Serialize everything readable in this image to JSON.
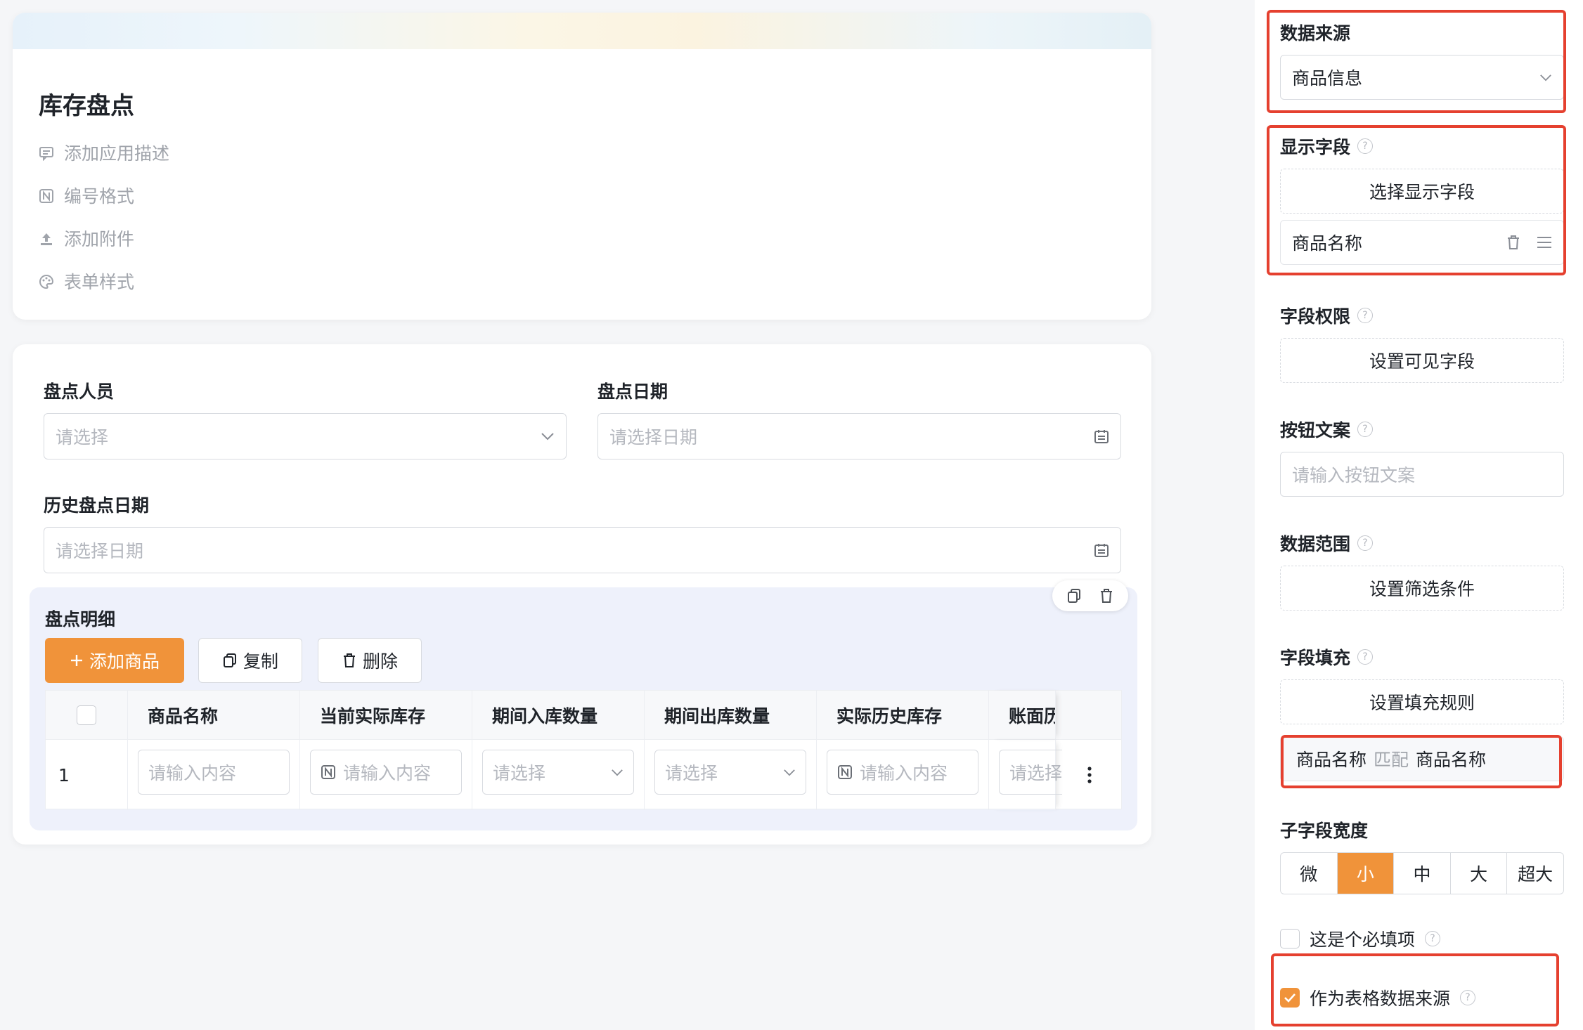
{
  "form": {
    "title": "库存盘点",
    "meta": [
      {
        "label": "添加应用描述",
        "icon": "comment-icon"
      },
      {
        "label": "编号格式",
        "icon": "numbering-icon"
      },
      {
        "label": "添加附件",
        "icon": "upload-icon"
      },
      {
        "label": "表单样式",
        "icon": "palette-icon"
      }
    ],
    "fields": {
      "inventory_person": {
        "label": "盘点人员",
        "placeholder": "请选择"
      },
      "inventory_date": {
        "label": "盘点日期",
        "placeholder": "请选择日期"
      },
      "history_date": {
        "label": "历史盘点日期",
        "placeholder": "请选择日期"
      }
    },
    "detail": {
      "title": "盘点明细",
      "add_label": "添加商品",
      "copy_label": "复制",
      "delete_label": "删除",
      "columns": [
        "商品名称",
        "当前实际库存",
        "期间入库数量",
        "期间出库数量",
        "实际历史库存",
        "账面历史"
      ],
      "row": {
        "index": "1",
        "cells": [
          "请输入内容",
          "请输入内容",
          "请选择",
          "请选择",
          "请输入内容",
          "请选择"
        ]
      }
    }
  },
  "props": {
    "data_source": {
      "label": "数据来源",
      "value": "商品信息"
    },
    "display_fields": {
      "label": "显示字段",
      "button": "选择显示字段",
      "items": [
        "商品名称"
      ]
    },
    "field_permission": {
      "label": "字段权限",
      "button": "设置可见字段"
    },
    "button_text": {
      "label": "按钮文案",
      "placeholder": "请输入按钮文案"
    },
    "data_range": {
      "label": "数据范围",
      "button": "设置筛选条件"
    },
    "field_fill": {
      "label": "字段填充",
      "button": "设置填充规则",
      "rule": {
        "target": "商品名称",
        "match": "匹配",
        "source": "商品名称"
      }
    },
    "width": {
      "label": "子字段宽度",
      "options": [
        "微",
        "小",
        "中",
        "大",
        "超大"
      ],
      "selected": "小"
    },
    "required": {
      "label": "这是个必填项",
      "checked": false
    },
    "as_table_source": {
      "label": "作为表格数据来源",
      "checked": true
    }
  },
  "colors": {
    "accent": "#f0933a",
    "highlight": "#e5402f"
  }
}
